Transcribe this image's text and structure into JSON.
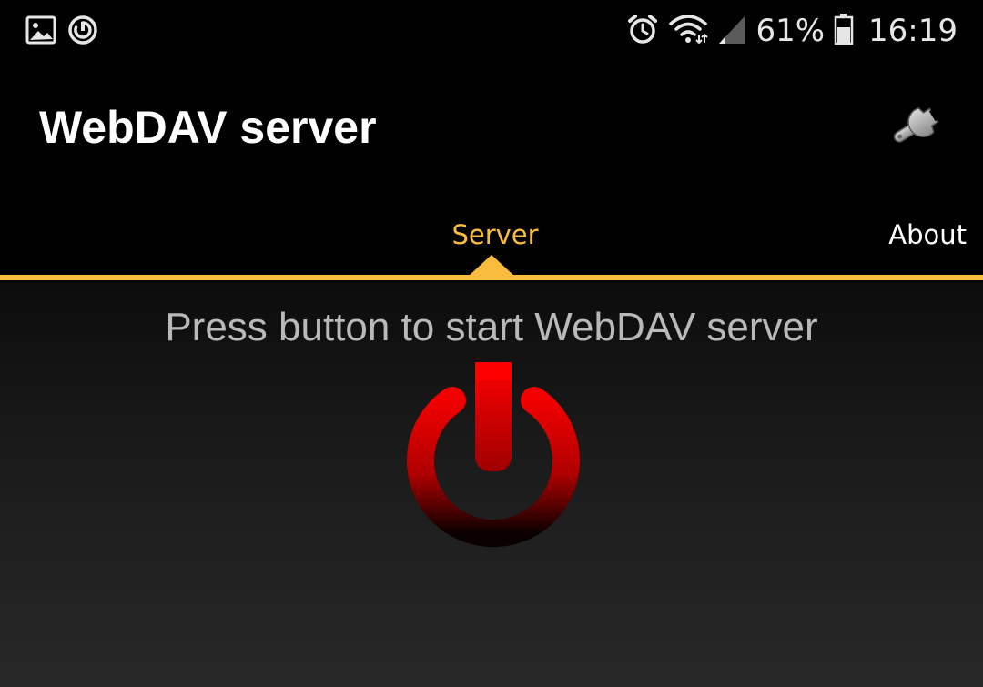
{
  "status_bar": {
    "left_icons": [
      "gallery-icon",
      "sync-icon"
    ],
    "right_icons": [
      "alarm-icon",
      "wifi-icon",
      "signal-icon",
      "battery-icon"
    ],
    "battery_percent": "61%",
    "time": "16:19"
  },
  "app_bar": {
    "title": "WebDAV server",
    "settings_icon": "wrench-icon"
  },
  "tabs": [
    {
      "label": "Server",
      "selected": true
    },
    {
      "label": "About",
      "selected": false
    }
  ],
  "main": {
    "prompt": "Press button to start WebDAV server",
    "power_button_icon": "power-icon"
  },
  "colors": {
    "accent": "#f9bc3c",
    "power_red": "#e00000",
    "prompt_text": "#b9b9b9"
  }
}
